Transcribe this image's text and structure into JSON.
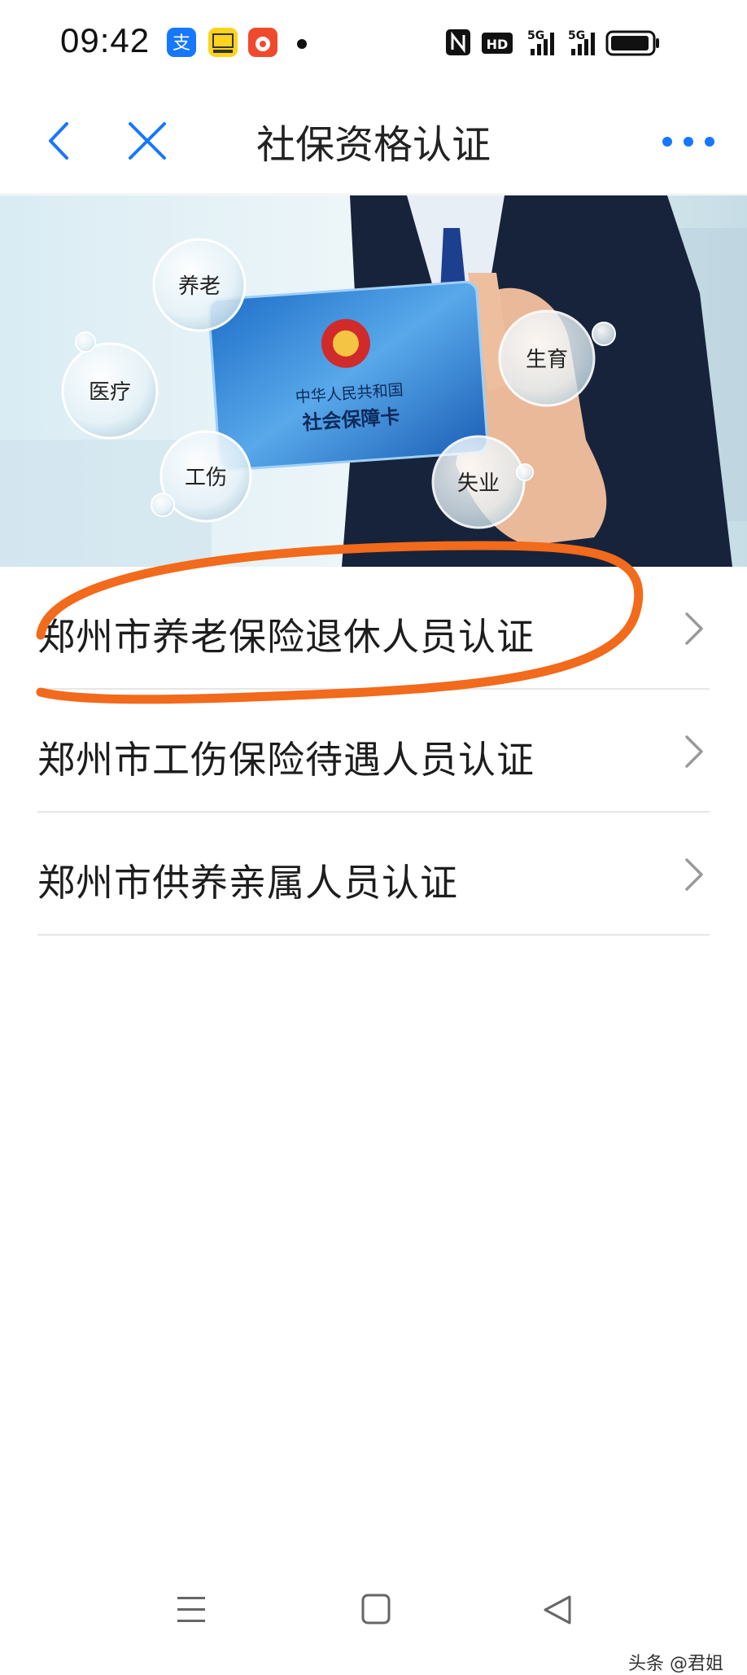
{
  "status_bar": {
    "time": "09:42",
    "icons": [
      "alipay-icon",
      "toutiao-icon",
      "red-app-icon",
      "dot-icon",
      "nfc-icon",
      "hd-icon",
      "signal-5g-icon",
      "signal-5g-icon",
      "battery-icon"
    ]
  },
  "nav": {
    "title": "社保资格认证",
    "back_icon": "chevron-left-icon",
    "close_icon": "close-icon",
    "more_icon": "more-dots-icon"
  },
  "banner": {
    "bubbles": [
      "养老",
      "医疗",
      "工伤",
      "生育",
      "失业"
    ],
    "card_line1": "中华人民共和国",
    "card_line2": "社会保障卡"
  },
  "list": {
    "items": [
      {
        "label": "郑州市养老保险退休人员认证"
      },
      {
        "label": "郑州市工伤保险待遇人员认证"
      },
      {
        "label": "郑州市供养亲属人员认证"
      }
    ]
  },
  "colors": {
    "accent": "#1677ff",
    "highlight": "#f26a1b"
  },
  "watermark": "头条 @君姐"
}
